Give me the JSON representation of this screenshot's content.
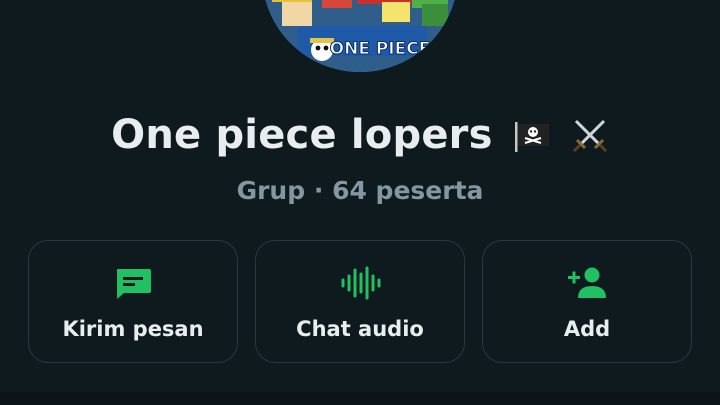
{
  "group": {
    "name": "One piece lopers",
    "emoji": [
      "pirate-flag-icon",
      "crossed-swords-icon"
    ],
    "type": "Grup",
    "separator": "·",
    "participants": "64 peserta",
    "avatar_logo_text": "ONE PIECE"
  },
  "actions": [
    {
      "label": "Kirim pesan",
      "icon": "message-icon"
    },
    {
      "label": "Chat audio",
      "icon": "audio-wave-icon"
    },
    {
      "label": "Add",
      "icon": "add-person-icon"
    }
  ],
  "colors": {
    "background": "#0f1a1f",
    "text_primary": "#e9edef",
    "text_secondary": "#8696a0",
    "accent": "#21c063",
    "card_border": "#2a373e"
  }
}
